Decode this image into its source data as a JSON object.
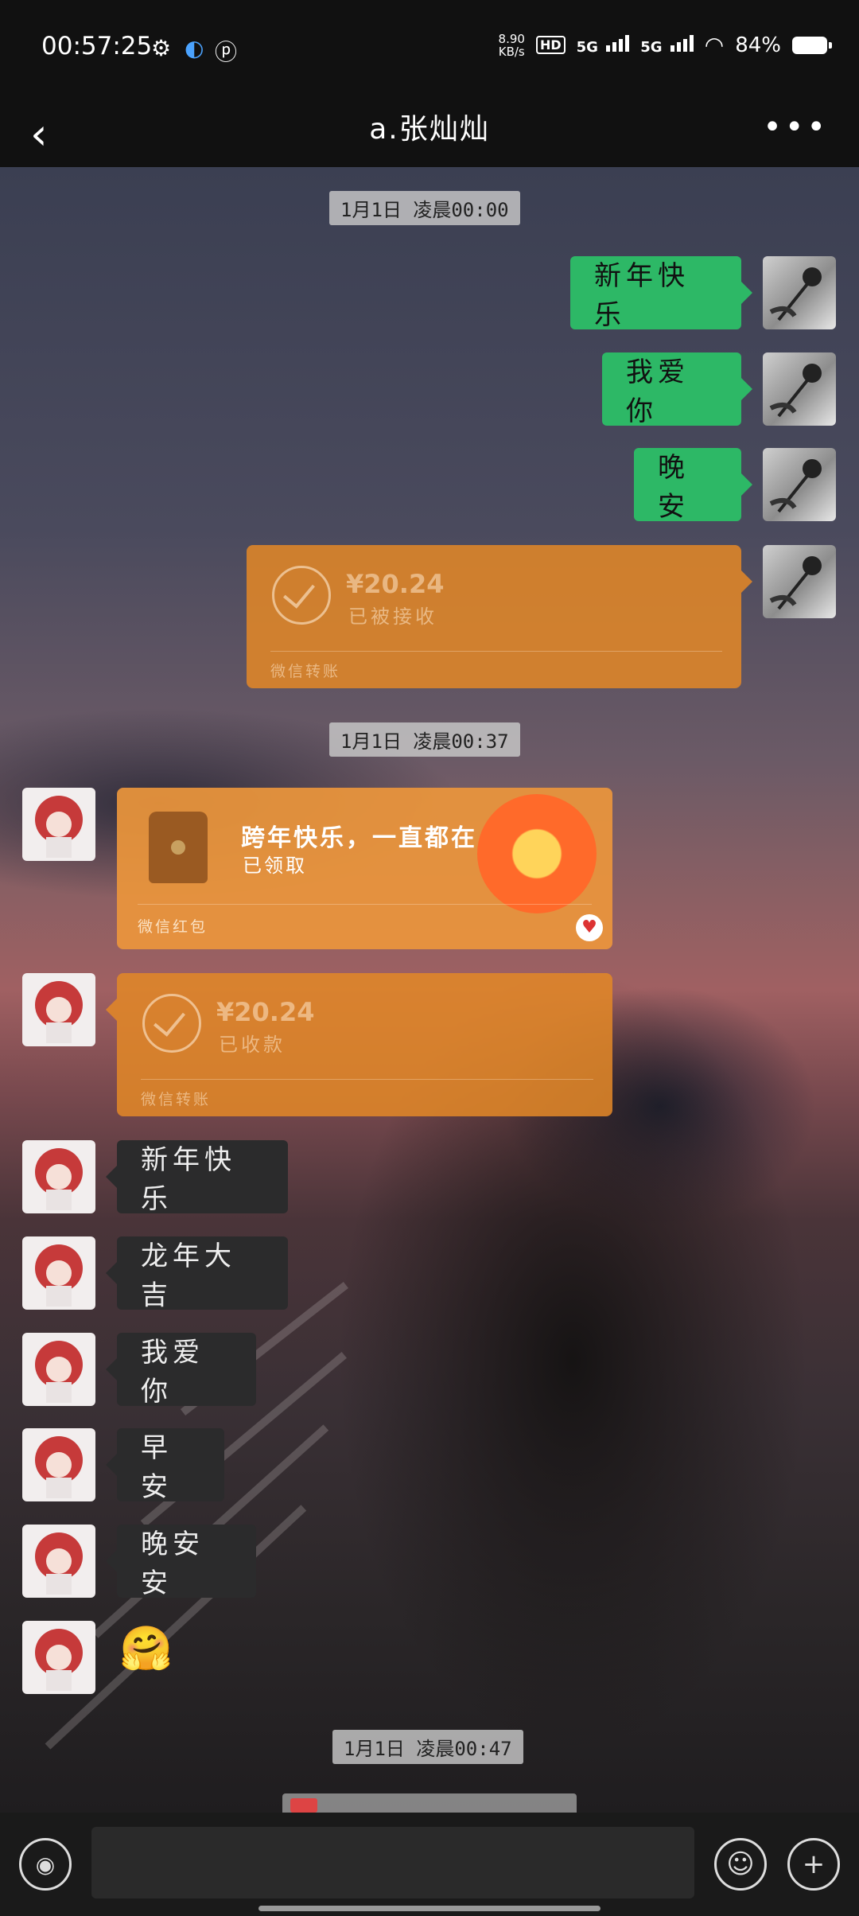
{
  "status_bar": {
    "time": "00:57:25",
    "net_speed": "8.90",
    "net_unit": "KB/s",
    "hd": "HD",
    "sim1": "5G",
    "sim2": "5G",
    "battery": "84%"
  },
  "header": {
    "title": "a.张灿灿"
  },
  "timestamps": {
    "t1": "1月1日 凌晨00:00",
    "t2": "1月1日 凌晨00:37",
    "t3": "1月1日 凌晨00:47"
  },
  "messages": {
    "me_1": "新年快乐",
    "me_2": "我爱你",
    "me_3": "晚安",
    "transfer_sent": {
      "amount": "¥20.24",
      "status": "已被接收",
      "label": "微信转账"
    },
    "red_packet": {
      "title": "跨年快乐，一直都在",
      "status": "已领取",
      "label": "微信红包"
    },
    "transfer_received": {
      "amount": "¥20.24",
      "status": "已收款",
      "label": "微信转账"
    },
    "other_1": "新年快乐",
    "other_2": "龙年大吉",
    "other_3": "我爱你",
    "other_4": "早安",
    "other_5": "晚安安",
    "other_emoji": "🤗"
  }
}
